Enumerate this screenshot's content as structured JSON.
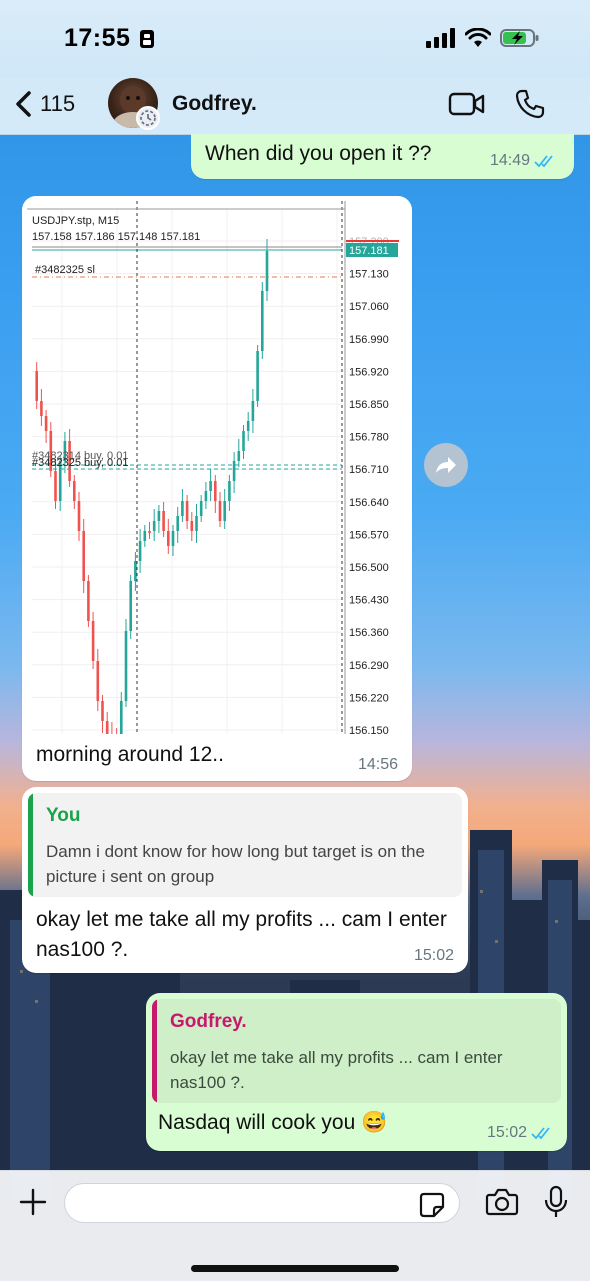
{
  "status_bar": {
    "time": "17:55"
  },
  "header": {
    "back_count": "115",
    "contact_name": "Godfrey."
  },
  "messages": [
    {
      "direction": "out",
      "text": "When did you open it ??",
      "time": "14:49",
      "read": true
    },
    {
      "direction": "in",
      "text": "morning around 12..",
      "time": "14:56",
      "image": {
        "symbol": "USDJPY.stp, M15",
        "ohlc": "157.158 157.186 157.148 157.181",
        "current_price": "157.181",
        "sl_label": "#3482325 sl",
        "order_label_back": "#3482314 buy, 0.01",
        "order_label": "#3482325 buy, 0.01",
        "price_axis": [
          "157.200",
          "157.130",
          "157.060",
          "156.990",
          "156.920",
          "156.850",
          "156.780",
          "156.710",
          "156.640",
          "156.570",
          "156.500",
          "156.430",
          "156.360",
          "156.290",
          "156.220",
          "156.150"
        ]
      }
    },
    {
      "direction": "in",
      "quote": {
        "author": "You",
        "text": "Damn i dont know for how long but target is on the picture i sent on group"
      },
      "text": "okay let me take all my profits ... cam I enter nas100 ?.",
      "time": "15:02"
    },
    {
      "direction": "out",
      "quote": {
        "author": "Godfrey.",
        "text": "okay let me take all my profits ... cam I enter nas100 ?."
      },
      "text": "Nasdaq will cook you 😅",
      "time": "15:02",
      "read": true
    }
  ],
  "composer": {
    "placeholder": ""
  },
  "colors": {
    "out_bubble": "#d9fdd3",
    "in_bubble": "#ffffff",
    "quote_you": "#1aa34a",
    "quote_godfrey": "#c7196b",
    "read_ticks": "#34b7f1",
    "chart_up": "#26a69a",
    "chart_down": "#ef5350"
  },
  "icons": {
    "back": "chevron-left-icon",
    "video": "video-camera-icon",
    "call": "phone-icon",
    "forward": "forward-arrow-icon",
    "attach": "plus-icon",
    "sticker": "sticker-icon",
    "camera": "camera-icon",
    "mic": "microphone-icon"
  }
}
